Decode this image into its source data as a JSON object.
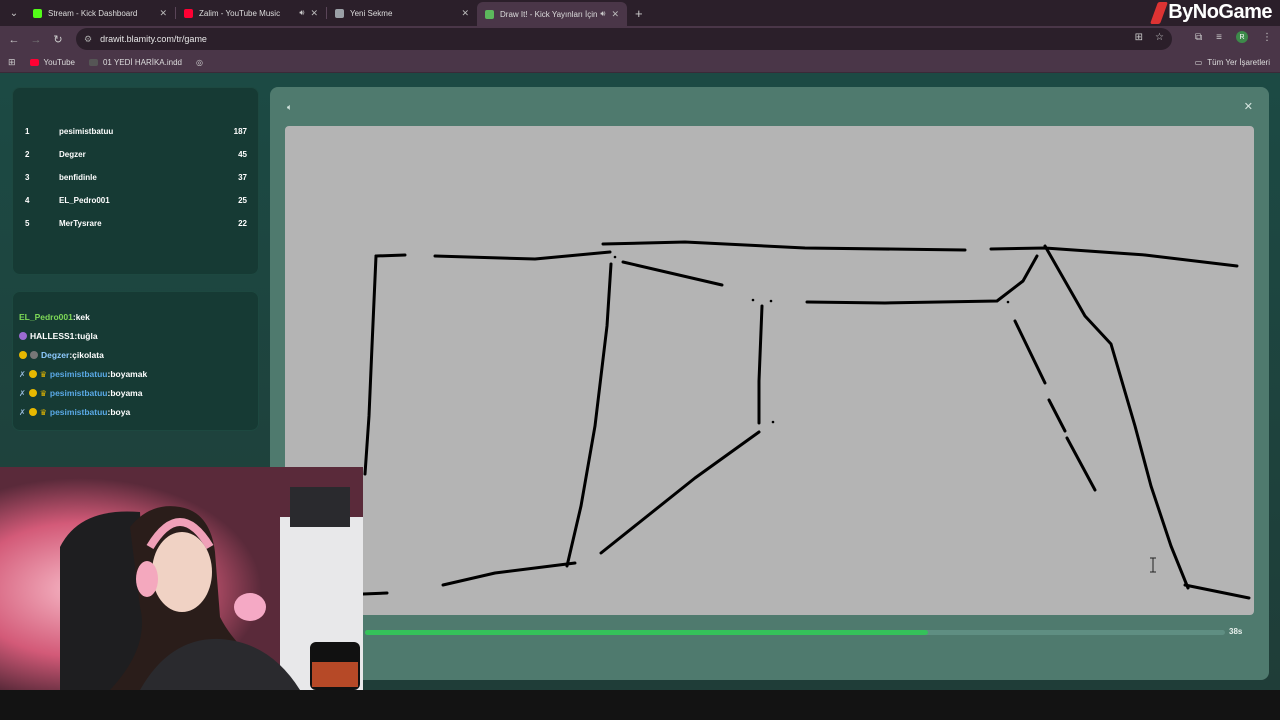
{
  "browser": {
    "tabs": [
      {
        "title": "Stream - Kick Dashboard",
        "fav_color": "#53fc18",
        "sound": false,
        "active": false
      },
      {
        "title": "Zalim - YouTube Music",
        "fav_color": "#ff0033",
        "sound": true,
        "active": false
      },
      {
        "title": "Yeni Sekme",
        "fav_color": "#9aa0a6",
        "sound": false,
        "active": false
      },
      {
        "title": "Draw It! - Kick Yayınları İçin",
        "fav_color": "#5cb85c",
        "sound": true,
        "active": true
      }
    ],
    "url": "drawit.blamity.com/tr/game",
    "logo_text": "ByNoGame",
    "avatar_letter": "R",
    "bookmarks": [
      {
        "label": "YouTube",
        "color": "#ff0033"
      },
      {
        "label": "01 YEDİ HARİKA.indd",
        "color": "#444"
      }
    ],
    "all_bookmarks": "Tüm Yer İşaretleri"
  },
  "leaderboard": {
    "rows": [
      {
        "rank": "1",
        "name": "pesimistbatuu",
        "points": "187"
      },
      {
        "rank": "2",
        "name": "Degzer",
        "points": "45"
      },
      {
        "rank": "3",
        "name": "benfidinle",
        "points": "37"
      },
      {
        "rank": "4",
        "name": "EL_Pedro001",
        "points": "25"
      },
      {
        "rank": "5",
        "name": "MerTysrare",
        "points": "22"
      }
    ]
  },
  "chat": {
    "messages": [
      {
        "user": "EL_Pedro001",
        "text": ":kek",
        "user_color": "#7ed957",
        "badges": []
      },
      {
        "user": "HALLESS1",
        "text": ":tuğla",
        "user_color": "#ffffff",
        "badges": [
          "sub"
        ]
      },
      {
        "user": "Degzer",
        "text": ":çikolata",
        "user_color": "#8ecbff",
        "badges": [
          "one",
          "sub"
        ]
      },
      {
        "user": "pesimistbatuu",
        "text": ":boyamak",
        "user_color": "#5aa9e6",
        "badges": [
          "sword",
          "one",
          "crown"
        ]
      },
      {
        "user": "pesimistbatuu",
        "text": ":boyama",
        "user_color": "#5aa9e6",
        "badges": [
          "sword",
          "one",
          "crown"
        ]
      },
      {
        "user": "pesimistbatuu",
        "text": ":boya",
        "user_color": "#5aa9e6",
        "badges": [
          "sword",
          "one",
          "crown"
        ]
      }
    ]
  },
  "game": {
    "timer": "38s",
    "progress_fraction": 0.655
  }
}
